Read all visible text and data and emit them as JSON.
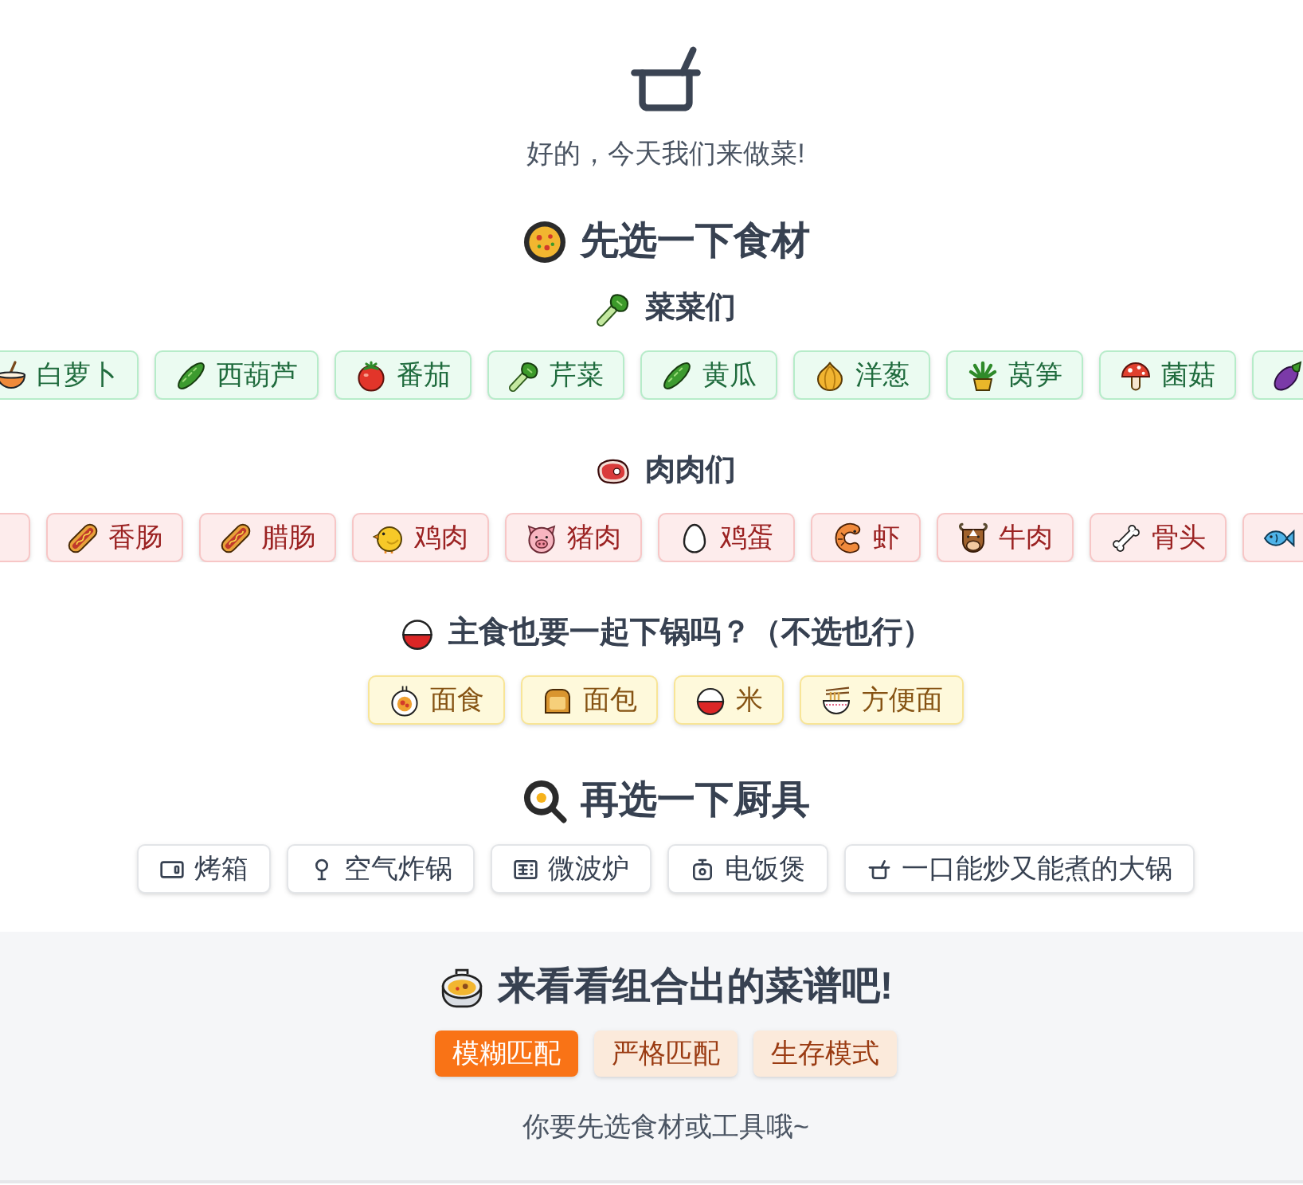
{
  "header": {
    "subtitle": "好的，今天我们来做菜!"
  },
  "ingredients": {
    "title": "先选一下食材",
    "groups": [
      {
        "kind": "vegetable",
        "title": "菜菜们",
        "items": [
          {
            "label": "白萝卜",
            "selected": false
          },
          {
            "label": "西葫芦",
            "selected": false
          },
          {
            "label": "番茄",
            "selected": false
          },
          {
            "label": "芹菜",
            "selected": false
          },
          {
            "label": "黄瓜",
            "selected": false
          },
          {
            "label": "洋葱",
            "selected": false
          },
          {
            "label": "莴笋",
            "selected": false
          },
          {
            "label": "菌菇",
            "selected": false
          },
          {
            "selected": false
          }
        ]
      },
      {
        "kind": "meat",
        "title": "肉肉们",
        "items": [
          {
            "selected": false
          },
          {
            "label": "香肠",
            "selected": false
          },
          {
            "label": "腊肠",
            "selected": false
          },
          {
            "label": "鸡肉",
            "selected": false
          },
          {
            "label": "猪肉",
            "selected": false
          },
          {
            "label": "鸡蛋",
            "selected": false
          },
          {
            "label": "虾",
            "selected": false
          },
          {
            "label": "牛肉",
            "selected": false
          },
          {
            "label": "骨头",
            "selected": false
          },
          {
            "selected": false
          }
        ]
      },
      {
        "kind": "staple",
        "title": "主食也要一起下锅吗？（不选也行）",
        "items": [
          {
            "label": "面食",
            "selected": false
          },
          {
            "label": "面包",
            "selected": false
          },
          {
            "label": "米",
            "selected": false
          },
          {
            "label": "方便面",
            "selected": false
          }
        ]
      }
    ]
  },
  "tools": {
    "title": "再选一下厨具",
    "items": [
      {
        "label": "烤箱",
        "selected": false
      },
      {
        "label": "空气炸锅",
        "selected": false
      },
      {
        "label": "微波炉",
        "selected": false
      },
      {
        "label": "电饭煲",
        "selected": false
      },
      {
        "label": "一口能炒又能煮的大锅",
        "selected": false
      }
    ]
  },
  "recipes": {
    "title": "来看看组合出的菜谱吧!",
    "modes": [
      {
        "label": "模糊匹配",
        "selected": true
      },
      {
        "label": "严格匹配",
        "selected": false
      },
      {
        "label": "生存模式",
        "selected": false
      }
    ],
    "message": "你要先选食材或工具哦~"
  }
}
